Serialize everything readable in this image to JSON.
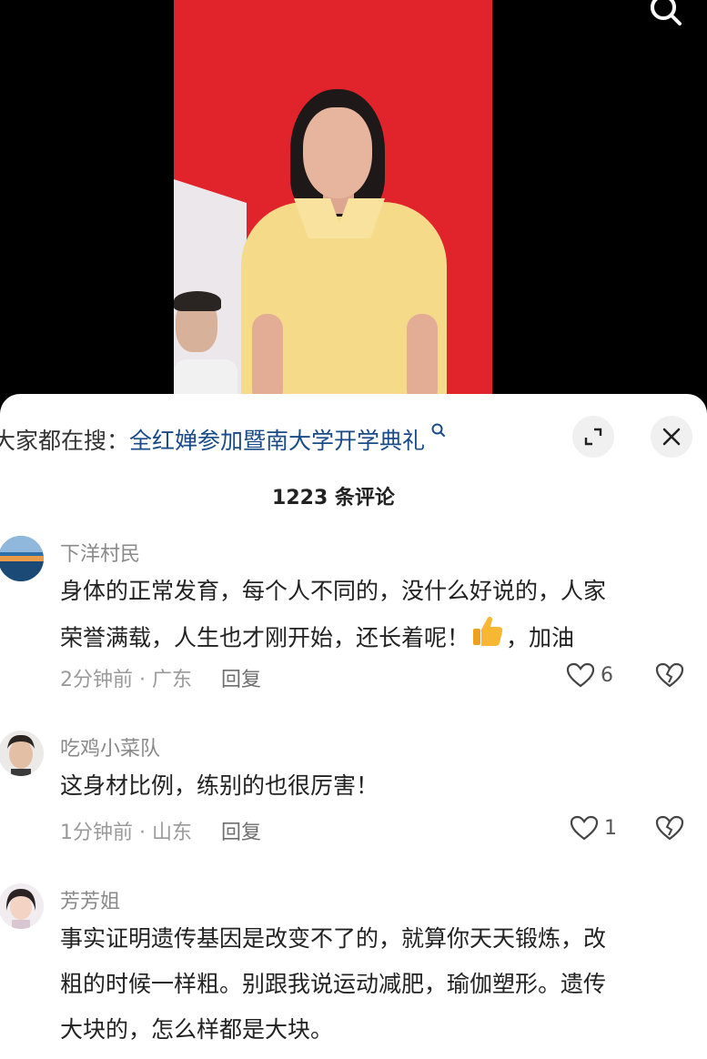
{
  "trending": {
    "prefix": "大家都在搜：",
    "query": "全红婵参加暨南大学开学典礼"
  },
  "comments_count": "1223 条评论",
  "comments": [
    {
      "user": "下洋村民",
      "text_line1": "身体的正常发育，每个人不同的，没什么好说的，人家",
      "text_line2_a": "荣誉满载，人生也才刚开始，还长着呢！",
      "text_line2_b": "，加油",
      "time": "2分钟前 · 广东",
      "reply": "回复",
      "likes": "6"
    },
    {
      "user": "吃鸡小菜队",
      "text_line1": "这身材比例，练别的也很厉害！",
      "time": "1分钟前 · 山东",
      "reply": "回复",
      "likes": "1"
    },
    {
      "user": "芳芳姐",
      "text_line1": "事实证明遗传基因是改变不了的，就算你天天锻炼，改",
      "text_line2": "粗的时候一样粗。别跟我说运动减肥，瑜伽塑形。遗传",
      "text_line3": "大块的，怎么样都是大块。"
    }
  ],
  "icons": {
    "search": "search-icon",
    "expand": "expand-icon",
    "close": "close-icon",
    "like": "heart-icon",
    "dislike": "broken-heart-icon",
    "thumbs_up": "thumbs-up-emoji"
  },
  "colors": {
    "link": "#1a4b86",
    "video_bg": "#e1232c"
  }
}
